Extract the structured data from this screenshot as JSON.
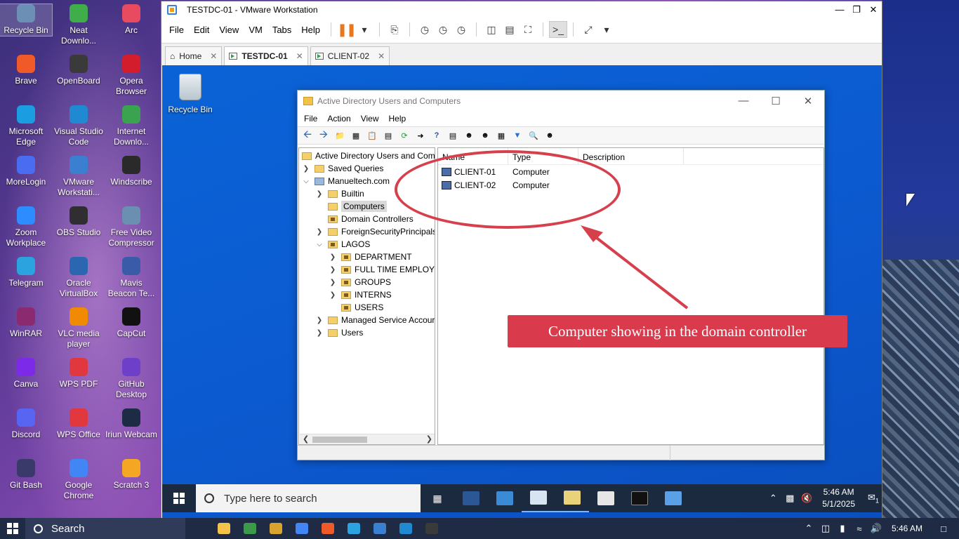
{
  "host": {
    "desktop_icons": [
      {
        "label": "Recycle Bin",
        "icon": "recycle-bin-icon",
        "color": "#6c8fb5"
      },
      {
        "label": "Neat Downlo...",
        "icon": "neat-download-icon",
        "color": "#3fae4a"
      },
      {
        "label": "Arc",
        "icon": "arc-icon",
        "color": "#e84a5f"
      },
      {
        "label": "Brave",
        "icon": "brave-icon",
        "color": "#f05a28"
      },
      {
        "label": "OpenBoard",
        "icon": "openboard-icon",
        "color": "#3a3a3a"
      },
      {
        "label": "Opera Browser",
        "icon": "opera-icon",
        "color": "#d41d2c"
      },
      {
        "label": "Microsoft Edge",
        "icon": "edge-icon",
        "color": "#1b9de2"
      },
      {
        "label": "Visual Studio Code",
        "icon": "vscode-icon",
        "color": "#1f8ad2"
      },
      {
        "label": "Internet Downlo...",
        "icon": "idm-icon",
        "color": "#3aa34f"
      },
      {
        "label": "MoreLogin",
        "icon": "morelogin-icon",
        "color": "#4a6cf0"
      },
      {
        "label": "VMware Workstati...",
        "icon": "vmware-icon",
        "color": "#3b7fd1"
      },
      {
        "label": "Windscribe",
        "icon": "windscribe-icon",
        "color": "#2a2a2a"
      },
      {
        "label": "Zoom Workplace",
        "icon": "zoom-icon",
        "color": "#2d8cff"
      },
      {
        "label": "OBS Studio",
        "icon": "obs-icon",
        "color": "#302e31"
      },
      {
        "label": "Free Video Compressor",
        "icon": "video-compressor-icon",
        "color": "#6b8fb0"
      },
      {
        "label": "Telegram",
        "icon": "telegram-icon",
        "color": "#2aa3de"
      },
      {
        "label": "Oracle VirtualBox",
        "icon": "virtualbox-icon",
        "color": "#2b66b0"
      },
      {
        "label": "Mavis Beacon Te...",
        "icon": "mavis-icon",
        "color": "#3a5ca8"
      },
      {
        "label": "WinRAR",
        "icon": "winrar-icon",
        "color": "#8b2a6e"
      },
      {
        "label": "VLC media player",
        "icon": "vlc-icon",
        "color": "#f08a00"
      },
      {
        "label": "CapCut",
        "icon": "capcut-icon",
        "color": "#111111"
      },
      {
        "label": "Canva",
        "icon": "canva-icon",
        "color": "#7d2ae8"
      },
      {
        "label": "WPS PDF",
        "icon": "wps-pdf-icon",
        "color": "#e0383e"
      },
      {
        "label": "GitHub Desktop",
        "icon": "github-desktop-icon",
        "color": "#6e40c9"
      },
      {
        "label": "Discord",
        "icon": "discord-icon",
        "color": "#5865f2"
      },
      {
        "label": "WPS Office",
        "icon": "wps-office-icon",
        "color": "#e0383e"
      },
      {
        "label": "Iriun Webcam",
        "icon": "iriun-icon",
        "color": "#1d2b45"
      },
      {
        "label": "Git Bash",
        "icon": "git-bash-icon",
        "color": "#3a3a6a"
      },
      {
        "label": "Google Chrome",
        "icon": "chrome-icon",
        "color": "#4285f4"
      },
      {
        "label": "Scratch 3",
        "icon": "scratch-icon",
        "color": "#f5a623"
      }
    ],
    "taskbar": {
      "search_placeholder": "Search",
      "clock": "5:46 AM",
      "apps": [
        {
          "icon": "file-explorer-icon",
          "color": "#f2c24a"
        },
        {
          "icon": "app-green-icon",
          "color": "#3a9a4a"
        },
        {
          "icon": "app-diamond-icon",
          "color": "#d9a330"
        },
        {
          "icon": "chrome-icon",
          "color": "#4285f4"
        },
        {
          "icon": "brave-icon",
          "color": "#f05a28"
        },
        {
          "icon": "telegram-icon",
          "color": "#2aa3de"
        },
        {
          "icon": "vmware-icon",
          "color": "#3b7fd1"
        },
        {
          "icon": "vscode-icon",
          "color": "#1f8ad2"
        },
        {
          "icon": "terminal-icon",
          "color": "#3a3a3a"
        }
      ]
    }
  },
  "vmware": {
    "title": "TESTDC-01 - VMware Workstation",
    "menu": [
      "File",
      "Edit",
      "View",
      "VM",
      "Tabs",
      "Help"
    ],
    "tabs": [
      {
        "label": "Home",
        "active": false
      },
      {
        "label": "TESTDC-01",
        "active": true
      },
      {
        "label": "CLIENT-02",
        "active": false
      }
    ]
  },
  "guest": {
    "desktop_icon": "Recycle Bin",
    "taskbar": {
      "search_placeholder": "Type here to search",
      "time": "5:46 AM",
      "date": "5/1/2025",
      "notification_count": "1"
    }
  },
  "aduc": {
    "title": "Active Directory Users and Computers",
    "menu": [
      "File",
      "Action",
      "View",
      "Help"
    ],
    "tree": [
      {
        "label": "Active Directory Users and Com",
        "level": 0,
        "arrow": "",
        "icon": "aduc"
      },
      {
        "label": "Saved Queries",
        "level": 1,
        "arrow": ">",
        "icon": "folder"
      },
      {
        "label": "Manueltech.com",
        "level": 1,
        "arrow": "v",
        "icon": "domain"
      },
      {
        "label": "Builtin",
        "level": 2,
        "arrow": ">",
        "icon": "folder"
      },
      {
        "label": "Computers",
        "level": 2,
        "arrow": "",
        "icon": "folder",
        "selected": true
      },
      {
        "label": "Domain Controllers",
        "level": 2,
        "arrow": "",
        "icon": "ou"
      },
      {
        "label": "ForeignSecurityPrincipals",
        "level": 2,
        "arrow": ">",
        "icon": "folder"
      },
      {
        "label": "LAGOS",
        "level": 2,
        "arrow": "v",
        "icon": "ou"
      },
      {
        "label": "DEPARTMENT",
        "level": 3,
        "arrow": ">",
        "icon": "ou"
      },
      {
        "label": "FULL TIME EMPLOYE",
        "level": 3,
        "arrow": ">",
        "icon": "ou"
      },
      {
        "label": "GROUPS",
        "level": 3,
        "arrow": ">",
        "icon": "ou"
      },
      {
        "label": "INTERNS",
        "level": 3,
        "arrow": ">",
        "icon": "ou"
      },
      {
        "label": "USERS",
        "level": 3,
        "arrow": "",
        "icon": "ou"
      },
      {
        "label": "Managed Service Accour",
        "level": 2,
        "arrow": ">",
        "icon": "folder"
      },
      {
        "label": "Users",
        "level": 2,
        "arrow": ">",
        "icon": "folder"
      }
    ],
    "columns": [
      "Name",
      "Type",
      "Description"
    ],
    "rows": [
      {
        "name": "CLIENT-01",
        "type": "Computer",
        "description": ""
      },
      {
        "name": "CLIENT-02",
        "type": "Computer",
        "description": ""
      }
    ]
  },
  "annotation": {
    "label": "Computer showing in the domain controller",
    "color": "#d93b4d"
  }
}
